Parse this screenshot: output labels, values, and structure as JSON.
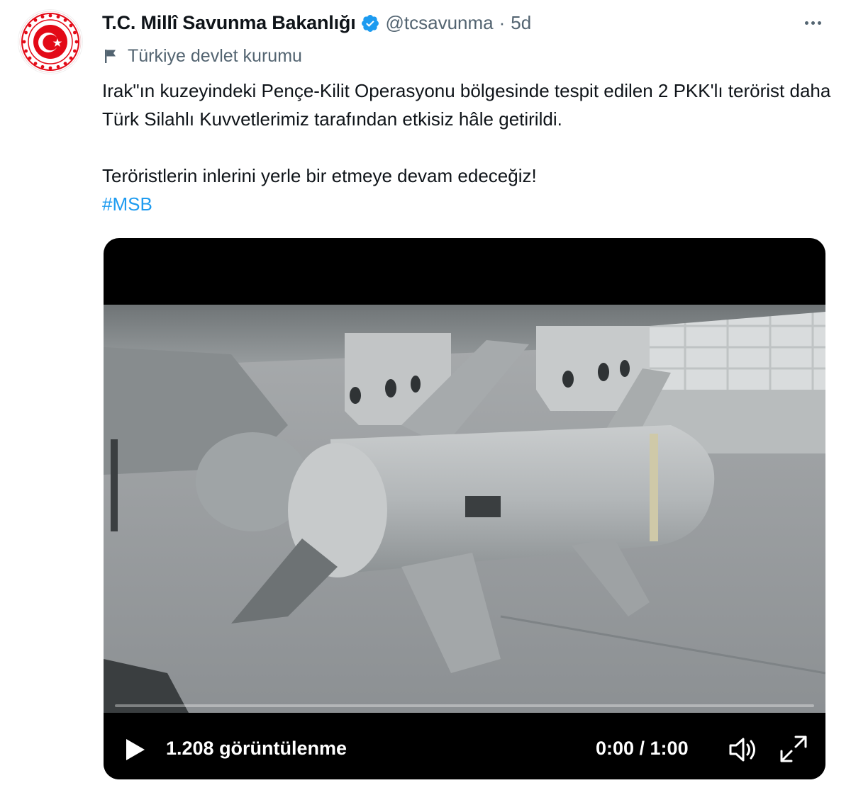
{
  "author": {
    "display_name": "T.C. Millî Savunma Bakanlığı",
    "handle": "@tcsavunma",
    "separator": "·",
    "time": "5d",
    "verified_icon": "verified-badge-icon",
    "avatar": "ministry-seal-avatar"
  },
  "label": {
    "icon": "flag-icon",
    "text": "Türkiye devlet kurumu"
  },
  "tweet": {
    "paragraph1": "Irak\"ın kuzeyindeki Pençe-Kilit Operasyonu bölgesinde tespit edilen 2 PKK'lı terörist daha Türk Silahlı Kuvvetlerimiz tarafından etkisiz hâle getirildi.",
    "paragraph2": "Teröristlerin inlerini yerle bir etmeye devam edeceğiz!",
    "hashtag": "#MSB"
  },
  "video": {
    "views": "1.208 görüntülenme",
    "time": "0:00 / 1:00",
    "progress": 0,
    "play_icon": "play-icon",
    "volume_icon": "volume-icon",
    "fullscreen_icon": "fullscreen-icon"
  },
  "colors": {
    "link": "#1d9bf0",
    "verified": "#1d9bf0",
    "seal_red": "#e30a17",
    "secondary_text": "#536471"
  }
}
